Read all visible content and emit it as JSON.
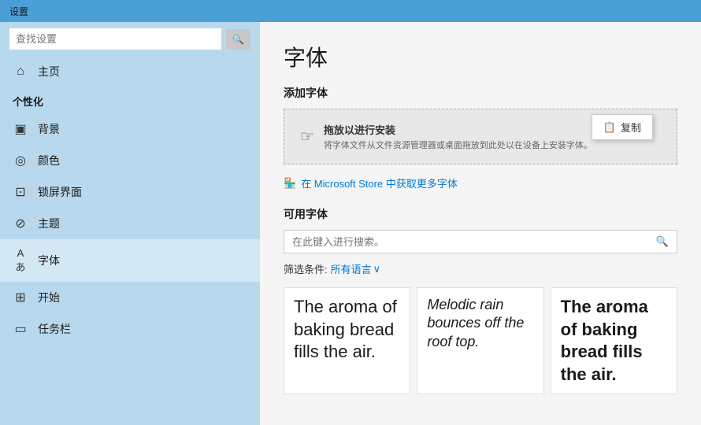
{
  "titlebar": {
    "label": "设置"
  },
  "sidebar": {
    "search_placeholder": "查找设置",
    "section_label": "个性化",
    "items": [
      {
        "id": "home",
        "icon": "⌂",
        "label": "主页"
      },
      {
        "id": "background",
        "icon": "▣",
        "label": "背景"
      },
      {
        "id": "color",
        "icon": "◎",
        "label": "颜色"
      },
      {
        "id": "lockscreen",
        "icon": "⊡",
        "label": "锁屏界面"
      },
      {
        "id": "theme",
        "icon": "⊘",
        "label": "主题"
      },
      {
        "id": "fonts",
        "icon": "Aあ",
        "label": "字体",
        "active": true
      },
      {
        "id": "start",
        "icon": "⊞",
        "label": "开始"
      },
      {
        "id": "taskbar",
        "icon": "▭",
        "label": "任务栏"
      }
    ]
  },
  "content": {
    "page_title": "字体",
    "add_fonts_section": "添加字体",
    "drop_zone": {
      "title": "拖放以进行安装",
      "description": "将字体文件从文件资源管理器或桌面拖放到此处以在设备上安装字体。"
    },
    "context_menu_item": "复制",
    "store_link": "在 Microsoft Store 中获取更多字体",
    "available_fonts_section": "可用字体",
    "search_placeholder": "在此键入进行搜索。",
    "filter_label": "筛选条件:",
    "filter_value": "所有语言",
    "font_previews": [
      {
        "text": "The aroma of baking bread fills the air.",
        "style": "normal"
      },
      {
        "text": "Melodic rain bounces off the roof top.",
        "style": "italic"
      },
      {
        "text": "The aroma of baking bread fills the air.",
        "style": "bold"
      }
    ]
  },
  "icons": {
    "search": "🔍",
    "copy": "📋",
    "store": "🏪",
    "cursor": "☞",
    "chevron": "∨"
  }
}
